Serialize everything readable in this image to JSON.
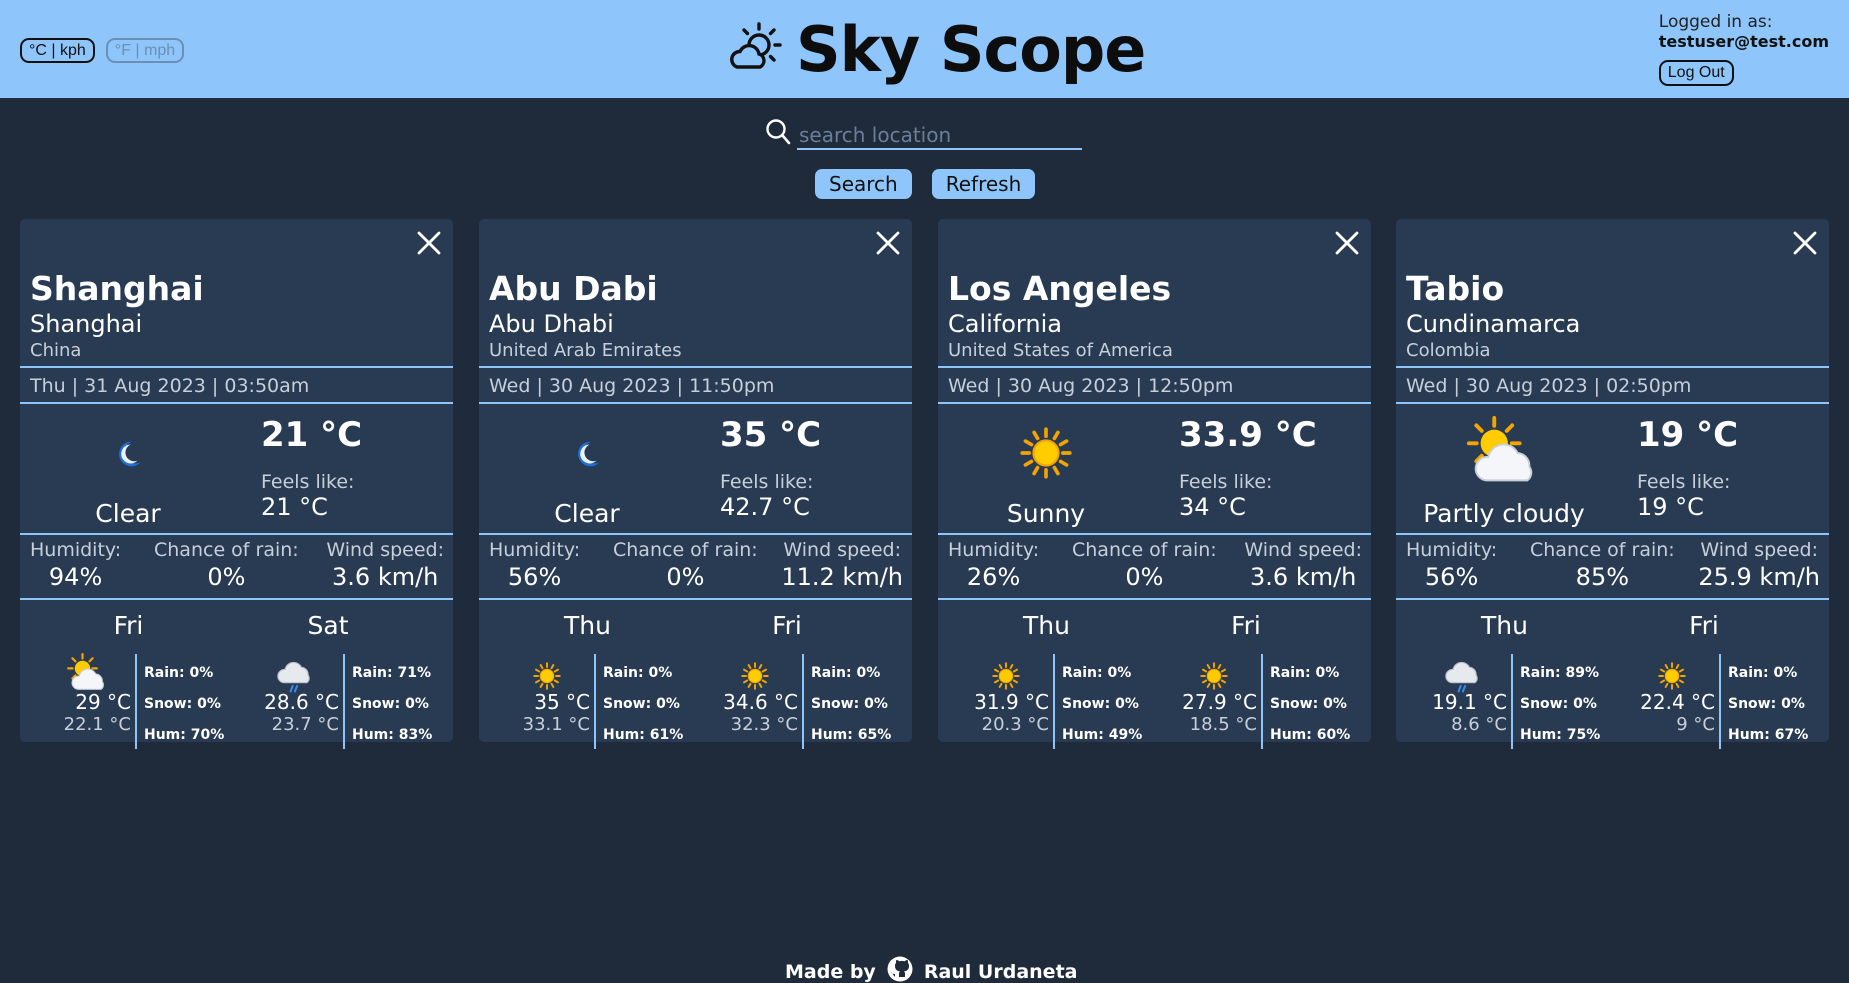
{
  "header": {
    "units": [
      {
        "label": "°C | kph",
        "active": true
      },
      {
        "label": "°F | mph",
        "active": false
      }
    ],
    "title": "Sky Scope",
    "logo_icon": "sun-cloud-icon",
    "user_label": "Logged in as:",
    "user_email": "testuser@test.com",
    "logout_label": "Log Out"
  },
  "search": {
    "placeholder": "search location",
    "value": "",
    "search_label": "Search",
    "refresh_label": "Refresh"
  },
  "labels": {
    "feels_like": "Feels like:",
    "humidity": "Humidity:",
    "chance_of_rain": "Chance of rain:",
    "wind_speed": "Wind speed:"
  },
  "cards": [
    {
      "name": "Shanghai",
      "region": "Shanghai",
      "country": "China",
      "datetime": "Thu | 31 Aug 2023 | 03:50am",
      "condition": "Clear",
      "icon": "moon-icon",
      "temp": "21 °C",
      "feels": "21 °C",
      "humidity": "94%",
      "rain_chance": "0%",
      "wind": "3.6 km/h",
      "forecast": [
        {
          "day": "Fri",
          "icon": "partly-cloudy-icon",
          "hi": "29 °C",
          "lo": "22.1 °C",
          "rain": "Rain: 0%",
          "snow": "Snow: 0%",
          "hum": "Hum: 70%"
        },
        {
          "day": "Sat",
          "icon": "rain-cloud-icon",
          "hi": "28.6 °C",
          "lo": "23.7 °C",
          "rain": "Rain: 71%",
          "snow": "Snow: 0%",
          "hum": "Hum: 83%"
        }
      ]
    },
    {
      "name": "Abu Dabi",
      "region": "Abu Dhabi",
      "country": "United Arab Emirates",
      "datetime": "Wed | 30 Aug 2023 | 11:50pm",
      "condition": "Clear",
      "icon": "moon-icon",
      "temp": "35 °C",
      "feels": "42.7 °C",
      "humidity": "56%",
      "rain_chance": "0%",
      "wind": "11.2 km/h",
      "forecast": [
        {
          "day": "Thu",
          "icon": "sun-icon",
          "hi": "35 °C",
          "lo": "33.1 °C",
          "rain": "Rain: 0%",
          "snow": "Snow: 0%",
          "hum": "Hum: 61%"
        },
        {
          "day": "Fri",
          "icon": "sun-icon",
          "hi": "34.6 °C",
          "lo": "32.3 °C",
          "rain": "Rain: 0%",
          "snow": "Snow: 0%",
          "hum": "Hum: 65%"
        }
      ]
    },
    {
      "name": "Los Angeles",
      "region": "California",
      "country": "United States of America",
      "datetime": "Wed | 30 Aug 2023 | 12:50pm",
      "condition": "Sunny",
      "icon": "sun-icon",
      "temp": "33.9 °C",
      "feels": "34 °C",
      "humidity": "26%",
      "rain_chance": "0%",
      "wind": "3.6 km/h",
      "forecast": [
        {
          "day": "Thu",
          "icon": "sun-icon",
          "hi": "31.9 °C",
          "lo": "20.3 °C",
          "rain": "Rain: 0%",
          "snow": "Snow: 0%",
          "hum": "Hum: 49%"
        },
        {
          "day": "Fri",
          "icon": "sun-icon",
          "hi": "27.9 °C",
          "lo": "18.5 °C",
          "rain": "Rain: 0%",
          "snow": "Snow: 0%",
          "hum": "Hum: 60%"
        }
      ]
    },
    {
      "name": "Tabio",
      "region": "Cundinamarca",
      "country": "Colombia",
      "datetime": "Wed | 30 Aug 2023 | 02:50pm",
      "condition": "Partly cloudy",
      "icon": "partly-cloudy-icon",
      "temp": "19 °C",
      "feels": "19 °C",
      "humidity": "56%",
      "rain_chance": "85%",
      "wind": "25.9 km/h",
      "forecast": [
        {
          "day": "Thu",
          "icon": "rain-cloud-icon",
          "hi": "19.1 °C",
          "lo": "8.6 °C",
          "rain": "Rain: 89%",
          "snow": "Snow: 0%",
          "hum": "Hum: 75%"
        },
        {
          "day": "Fri",
          "icon": "sun-icon",
          "hi": "22.4 °C",
          "lo": "9 °C",
          "rain": "Rain: 0%",
          "snow": "Snow: 0%",
          "hum": "Hum: 67%"
        }
      ]
    }
  ],
  "footer": {
    "made_by": "Made by",
    "icon": "github-icon",
    "author": "Raul Urdaneta"
  },
  "colors": {
    "background": "#1f2a3a",
    "header": "#8ec5fb",
    "card": "#293b52",
    "accent": "#8ec5fb"
  }
}
